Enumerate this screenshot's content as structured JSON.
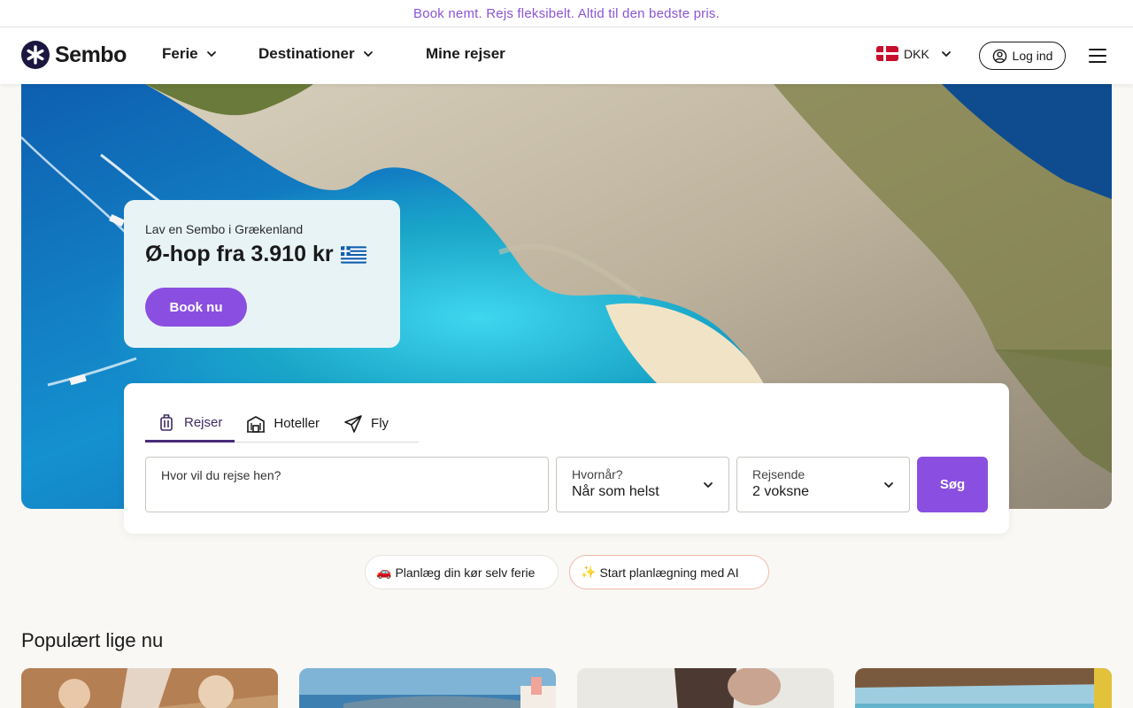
{
  "topbar": {
    "text": "Book nemt. Rejs fleksibelt. Altid til den bedste pris."
  },
  "nav": {
    "logo_text": "Sembo",
    "items": [
      {
        "label": "Ferie",
        "dropdown": true
      },
      {
        "label": "Destinationer",
        "dropdown": true
      },
      {
        "label": "Mine rejser",
        "dropdown": false
      }
    ],
    "currency": "DKK",
    "login": "Log ind"
  },
  "promo": {
    "subtitle": "Lav en Sembo i Grækenland",
    "title": "Ø-hop fra 3.910 kr",
    "button": "Book nu"
  },
  "search": {
    "tabs": [
      {
        "label": "Rejser",
        "icon": "luggage-icon",
        "active": true
      },
      {
        "label": "Hoteller",
        "icon": "hotel-icon",
        "active": false
      },
      {
        "label": "Fly",
        "icon": "plane-icon",
        "active": false
      }
    ],
    "destination_placeholder": "Hvor vil du rejse hen?",
    "when": {
      "label": "Hvornår?",
      "value": "Når som helst"
    },
    "travelers": {
      "label": "Rejsende",
      "value": "2 voksne"
    },
    "button": "Søg"
  },
  "chips": [
    {
      "emoji": "🚗",
      "label": "Planlæg din kør selv ferie"
    },
    {
      "emoji": "✨",
      "label": "Start planlægning med AI"
    }
  ],
  "popular": {
    "title": "Populært lige nu"
  },
  "colors": {
    "brand": "#8a4fe0",
    "topbar_text": "#8a55d6",
    "sea": "#1aa6c8"
  }
}
